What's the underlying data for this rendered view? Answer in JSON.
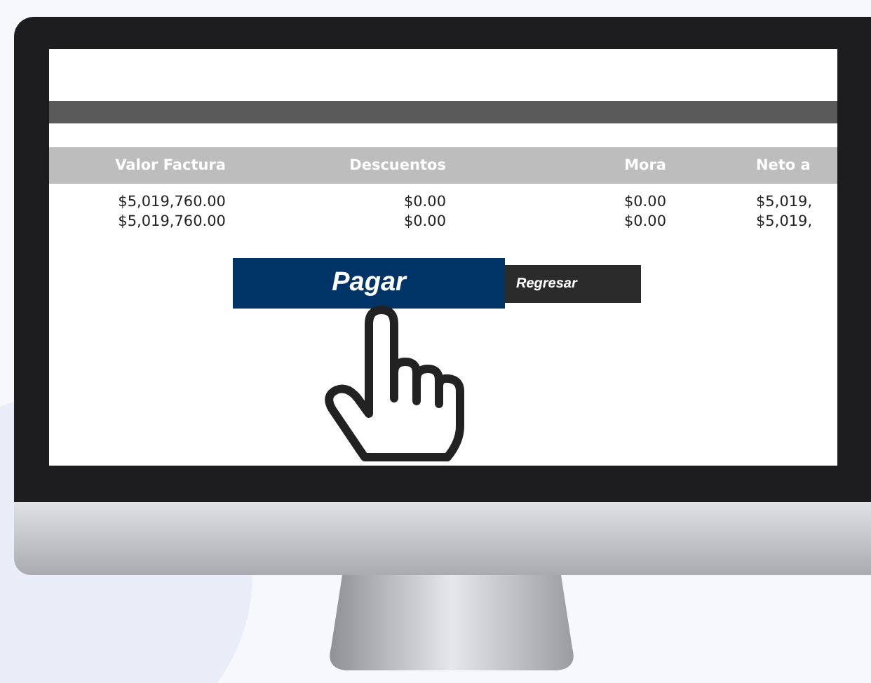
{
  "table": {
    "columns": [
      "Valor Factura",
      "Descuentos",
      "Mora",
      "Neto a"
    ],
    "rows": [
      [
        "$5,019,760.00",
        "$0.00",
        "$0.00",
        "$5,019,"
      ],
      [
        "$5,019,760.00",
        "$0.00",
        "$0.00",
        "$5,019,"
      ]
    ]
  },
  "buttons": [
    {
      "label": "Pagar",
      "kind": "primary"
    },
    {
      "label": "Regresar",
      "kind": "secondary"
    }
  ]
}
